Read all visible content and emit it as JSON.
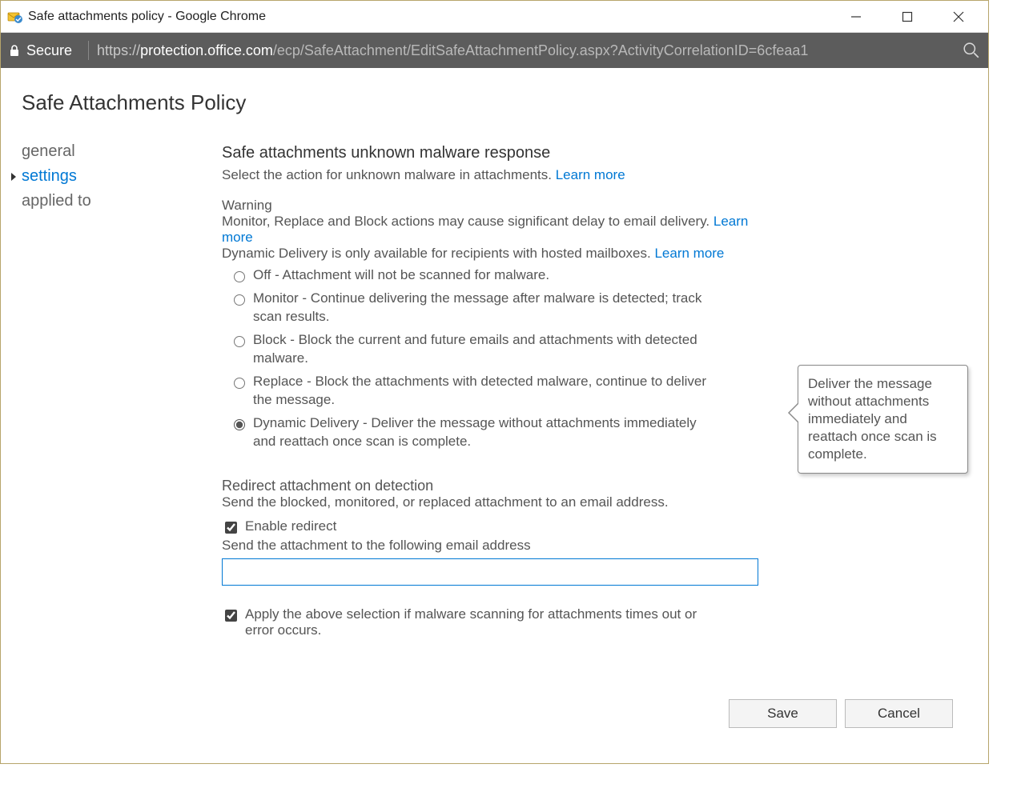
{
  "window": {
    "title": "Safe attachments policy - Google Chrome"
  },
  "addressbar": {
    "secure_label": "Secure",
    "protocol": "https://",
    "host": "protection.office.com",
    "path": "/ecp/SafeAttachment/EditSafeAttachmentPolicy.aspx?ActivityCorrelationID=6cfeaa1"
  },
  "page": {
    "title": "Safe Attachments Policy"
  },
  "sidebar": {
    "items": [
      {
        "label": "general",
        "active": false
      },
      {
        "label": "settings",
        "active": true
      },
      {
        "label": "applied to",
        "active": false
      }
    ]
  },
  "main": {
    "section_heading": "Safe attachments unknown malware response",
    "section_desc": "Select the action for unknown malware in attachments. ",
    "learn_more": "Learn more",
    "warning_label": "Warning",
    "warning_line1": "Monitor, Replace and Block actions may cause significant delay to email delivery. ",
    "warning_line2": "Dynamic Delivery is only available for recipients with hosted mailboxes. ",
    "options": [
      {
        "id": "off",
        "label": "Off - Attachment will not be scanned for malware."
      },
      {
        "id": "monitor",
        "label": "Monitor - Continue delivering the message after malware is detected; track scan results."
      },
      {
        "id": "block",
        "label": "Block - Block the current and future emails and attachments with detected malware."
      },
      {
        "id": "replace",
        "label": "Replace - Block the attachments with detected malware, continue to deliver the message."
      },
      {
        "id": "dynamic",
        "label": "Dynamic Delivery - Deliver the message without attachments immediately and reattach once scan is complete."
      }
    ],
    "selected_option": "dynamic",
    "redirect": {
      "heading": "Redirect attachment on detection",
      "desc": "Send the blocked, monitored, or replaced attachment to an email address.",
      "enable_label": "Enable redirect",
      "enable_checked": true,
      "send_label": "Send the attachment to the following email address",
      "email_value": ""
    },
    "apply_timeout": {
      "label": "Apply the above selection if malware scanning for attachments times out or error occurs.",
      "checked": true
    }
  },
  "tooltip": {
    "text": "Deliver the message without attachments immediately and reattach once scan is complete."
  },
  "footer": {
    "save": "Save",
    "cancel": "Cancel"
  }
}
